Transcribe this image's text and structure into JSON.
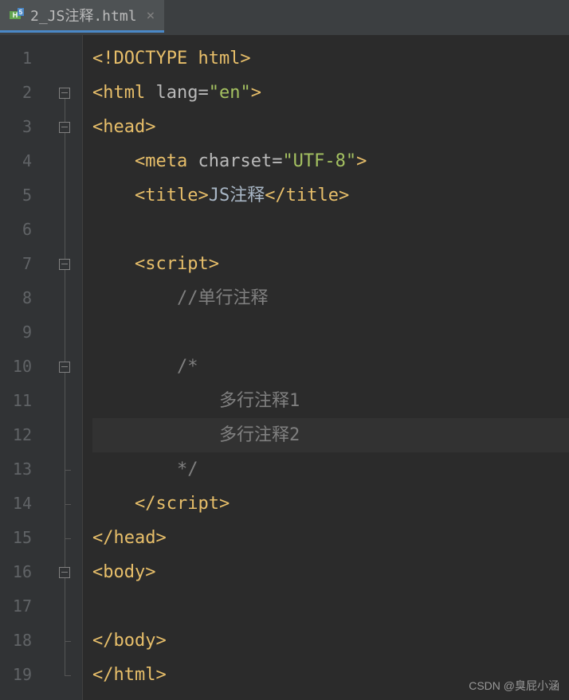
{
  "tab": {
    "filename": "2_JS注释.html",
    "close": "×"
  },
  "lines": [
    {
      "num": "1",
      "fold": "none"
    },
    {
      "num": "2",
      "fold": "open"
    },
    {
      "num": "3",
      "fold": "open"
    },
    {
      "num": "4",
      "fold": "line"
    },
    {
      "num": "5",
      "fold": "line"
    },
    {
      "num": "6",
      "fold": "line"
    },
    {
      "num": "7",
      "fold": "open"
    },
    {
      "num": "8",
      "fold": "line"
    },
    {
      "num": "9",
      "fold": "line"
    },
    {
      "num": "10",
      "fold": "open"
    },
    {
      "num": "11",
      "fold": "line"
    },
    {
      "num": "12",
      "fold": "line"
    },
    {
      "num": "13",
      "fold": "close"
    },
    {
      "num": "14",
      "fold": "close"
    },
    {
      "num": "15",
      "fold": "close"
    },
    {
      "num": "16",
      "fold": "open"
    },
    {
      "num": "17",
      "fold": "line"
    },
    {
      "num": "18",
      "fold": "close"
    },
    {
      "num": "19",
      "fold": "close"
    }
  ],
  "code": {
    "l1": {
      "t1": "<!DOCTYPE html>"
    },
    "l2": {
      "open": "<",
      "tag": "html",
      "sp": " ",
      "attr": "lang",
      "eq": "=",
      "val": "\"en\"",
      "close": ">"
    },
    "l3": {
      "open": "<",
      "tag": "head",
      "close": ">"
    },
    "l4": {
      "open": "<",
      "tag": "meta",
      "sp": " ",
      "attr": "charset",
      "eq": "=",
      "val": "\"UTF-8\"",
      "close": ">"
    },
    "l5": {
      "open1": "<",
      "tag1": "title",
      "close1": ">",
      "text": "JS注释",
      "open2": "</",
      "tag2": "title",
      "close2": ">"
    },
    "l7": {
      "open": "<",
      "tag": "script",
      "close": ">"
    },
    "l8": {
      "c": "//单行注释"
    },
    "l10": {
      "c": "/*"
    },
    "l11": {
      "c": "多行注释1"
    },
    "l12": {
      "c": "多行注释2"
    },
    "l13": {
      "c": "*/"
    },
    "l14": {
      "open": "</",
      "tag": "script",
      "close": ">"
    },
    "l15": {
      "open": "</",
      "tag": "head",
      "close": ">"
    },
    "l16": {
      "open": "<",
      "tag": "body",
      "close": ">"
    },
    "l18": {
      "open": "</",
      "tag": "body",
      "close": ">"
    },
    "l19": {
      "open": "</",
      "tag": "html",
      "close": ">"
    }
  },
  "watermark": "CSDN @臭屁小涵"
}
